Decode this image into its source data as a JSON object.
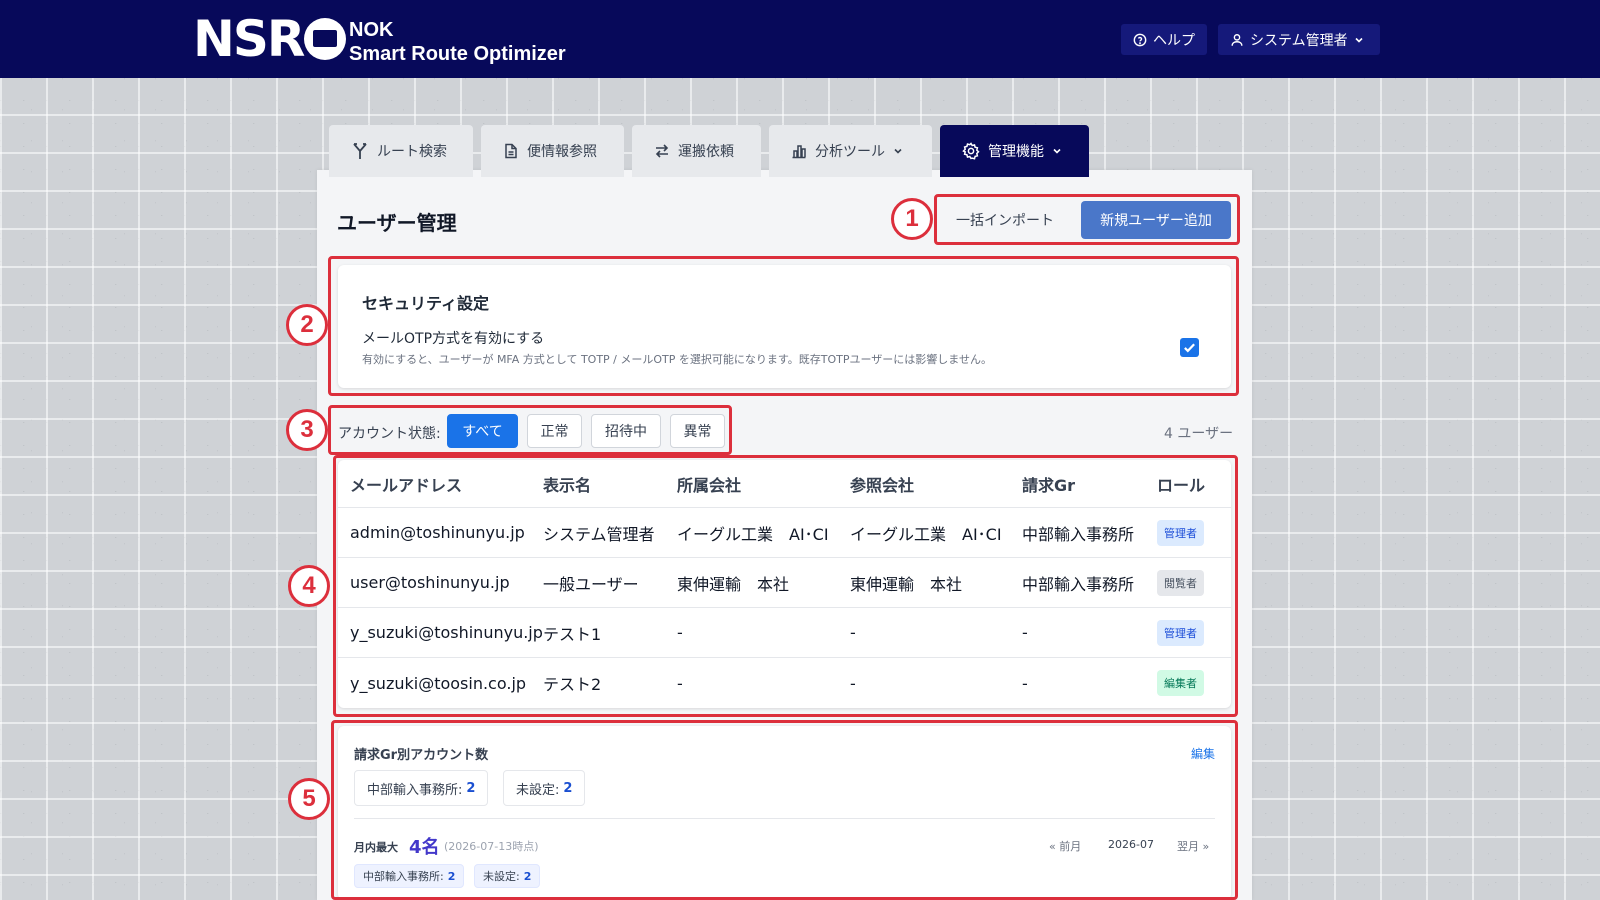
{
  "header": {
    "logo": "NSRO",
    "brand": "NOK",
    "product": "Smart Route Optimizer",
    "help_label": "ヘルプ",
    "user_label": "システム管理者"
  },
  "tabs": [
    {
      "label": "ルート検索",
      "icon": "route-icon"
    },
    {
      "label": "便情報参照",
      "icon": "document-icon"
    },
    {
      "label": "運搬依頼",
      "icon": "swap-icon"
    },
    {
      "label": "分析ツール",
      "icon": "bar-chart-icon"
    },
    {
      "label": "管理機能",
      "icon": "gear-icon",
      "active": true
    }
  ],
  "page": {
    "title": "ユーザー管理",
    "import_label": "一括インポート",
    "add_label": "新規ユーザー追加"
  },
  "security": {
    "title": "セキュリティ設定",
    "option_label": "メールOTP方式を有効にする",
    "option_desc": "有効にすると、ユーザーが MFA 方式として TOTP / メールOTP を選択可能になります。既存TOTPユーザーには影響しません。",
    "enabled": true
  },
  "filter": {
    "label": "アカウント状態:",
    "options": [
      "すべて",
      "正常",
      "招待中",
      "異常"
    ],
    "selected": "すべて",
    "count": "4 ユーザー"
  },
  "table": {
    "columns": [
      "メールアドレス",
      "表示名",
      "所属会社",
      "参照会社",
      "請求Gr",
      "ロール"
    ],
    "rows": [
      {
        "email": "admin@toshinunyu.jp",
        "name": "システム管理者",
        "company": "イーグル工業　AI･CI",
        "ref_company": "イーグル工業　AI･CI",
        "billing": "中部輸入事務所",
        "role": "管理者"
      },
      {
        "email": "user@toshinunyu.jp",
        "name": "一般ユーザー",
        "company": "東伸運輸　本社",
        "ref_company": "東伸運輸　本社",
        "billing": "中部輸入事務所",
        "role": "閲覧者"
      },
      {
        "email": "y_suzuki@toshinunyu.jp",
        "name": "テスト1",
        "company": "-",
        "ref_company": "-",
        "billing": "-",
        "role": "管理者"
      },
      {
        "email": "y_suzuki@toosin.co.jp",
        "name": "テスト2",
        "company": "-",
        "ref_company": "-",
        "billing": "-",
        "role": "編集者"
      }
    ]
  },
  "billing_groups": {
    "title": "請求Gr別アカウント数",
    "edit_label": "編集",
    "chips": [
      {
        "label": "中部輸入事務所:",
        "count": "2"
      },
      {
        "label": "未設定:",
        "count": "2"
      }
    ],
    "monthly_max_label": "月内最大",
    "monthly_max_value": "4名",
    "monthly_max_date": "(2026-07-13時点)",
    "prev_label": "« 前月",
    "current_month": "2026-07",
    "next_label": "翌月 »",
    "month_chips": [
      {
        "label": "中部輸入事務所:",
        "count": "2"
      },
      {
        "label": "未設定:",
        "count": "2"
      }
    ]
  },
  "annotations": [
    "1",
    "2",
    "3",
    "4",
    "5"
  ],
  "colors": {
    "navy": "#07095a",
    "accent": "#1a73e8",
    "annotation": "#dc2f3c"
  }
}
